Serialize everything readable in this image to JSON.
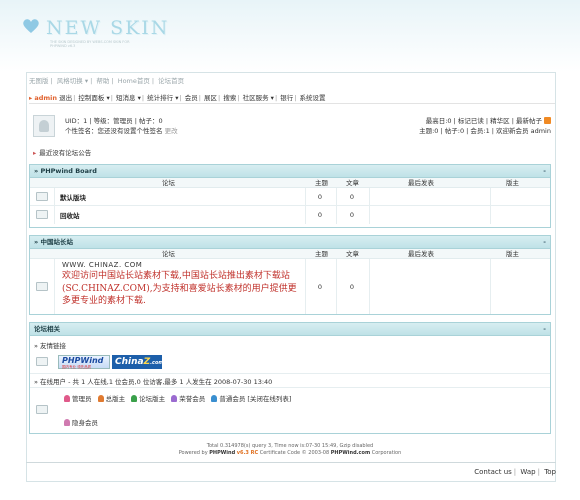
{
  "logo": {
    "title": "NEW SKIN",
    "subtitle": "THE SKIN DESIGNED BY WEBS.COM SKIN FOR PHPWIND v6.3"
  },
  "topnav": [
    "无图版",
    "风格切换 ▾",
    "帮助",
    "Home首页",
    "论坛首页"
  ],
  "mainnav": {
    "user": "admin",
    "items": [
      "退出",
      "控制面板 ▾",
      "短消息 ▾",
      "统计排行 ▾",
      "会员",
      "展区",
      "搜索",
      "社区服务 ▾",
      "银行",
      "系统设置"
    ]
  },
  "user_panel": {
    "line1": "UID：1 | 等级：管理员 | 帖子：0",
    "sig_label": "个性签名：",
    "sig_value": "您还没有设置个性签名",
    "sig_edit": "更改"
  },
  "stats": {
    "line1": "最高日:0 | 标记已读 | 精华区 | 最新帖子",
    "line2": "主题:0 | 帖子:0 | 会员:1 | 欢迎新会员 admin"
  },
  "notice": "最近没有论坛公告",
  "board1": {
    "title": "PHPwind Board",
    "collapse": "-",
    "columns": {
      "forum": "论坛",
      "topics": "主题",
      "posts": "文章",
      "last": "最后发表",
      "mod": "版主"
    },
    "rows": [
      {
        "name": "默认版块",
        "topics": "0",
        "posts": "0"
      },
      {
        "name": "回收站",
        "topics": "0",
        "posts": "0"
      }
    ]
  },
  "board2": {
    "title": "中国站长站",
    "collapse": "-",
    "columns": {
      "forum": "论坛",
      "topics": "主题",
      "posts": "文章",
      "last": "最后发表",
      "mod": "版主"
    },
    "url": "WWW. CHINAZ. COM",
    "promo": "欢迎访问中国站长站素材下载,中国站长站推出素材下载站(SC.CHINAZ.COM),为支持和喜爱站长素材的用户提供更多更专业的素材下载.",
    "topics": "0",
    "posts": "0"
  },
  "board3": {
    "title": "论坛相关",
    "collapse": "-",
    "links_label": "友情链接",
    "logo_pw": "PHPWind",
    "logo_pw_sub": "国内专业 领先品质",
    "logo_cz_a": "China",
    "logo_cz_b": "Z",
    "logo_cz_c": ".com",
    "online": "在线用户 - 共 1 人在线,1 位会员,0 位访客,最多 1 人发生在 2008-07-30 13:40",
    "legend": [
      "管理员",
      "总版主",
      "论坛版主",
      "荣誉会员",
      "普通会员",
      "[关闭在线列表]"
    ],
    "legend_colors": [
      "#e05a8a",
      "#e07a30",
      "#3aa04a",
      "#9b6bd0",
      "#3a8fd0"
    ],
    "hidden": "隐身会员"
  },
  "footer": {
    "line1": "Total 0.314978(s) query 3, Time now is:07-30 15:49, Gzip disabled",
    "powered": "Powered by",
    "brand": "PHPWind",
    "ver": "v6.3 RC",
    "line2_rest": "Certificate Code © 2003-08",
    "brand2": "PHPWind.com",
    "corp": "Corporation"
  },
  "bottom_links": [
    "Contact us",
    "Wap",
    "Top"
  ]
}
